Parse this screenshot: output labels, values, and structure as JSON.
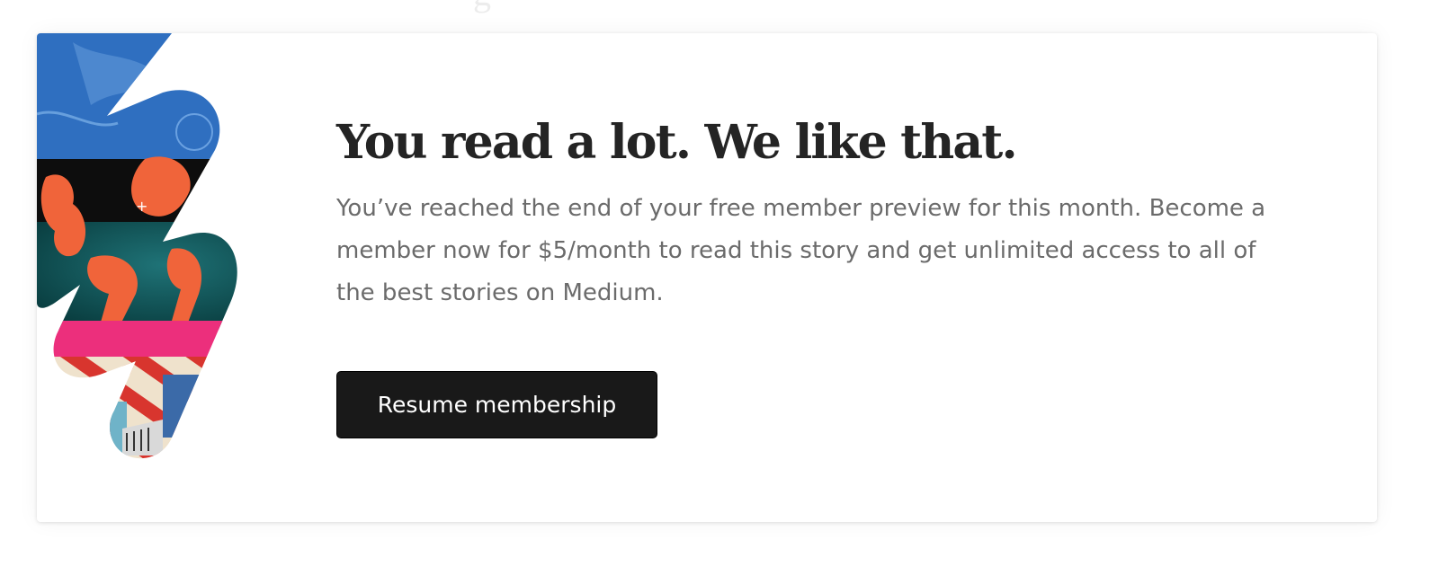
{
  "paywall": {
    "headline": "You read a lot. We like that.",
    "body": "You’ve reached the end of your free member preview for this month. Become a member now for $5/month to read this story and get unlimited access to all of the best stories on Medium.",
    "button_label": "Resume membership",
    "illustration": "lightning-bolt-collage-icon"
  },
  "colors": {
    "headline": "#242424",
    "body": "#6b6b6b",
    "button_bg": "#191919",
    "button_text": "#ffffff",
    "card_bg": "#ffffff"
  }
}
